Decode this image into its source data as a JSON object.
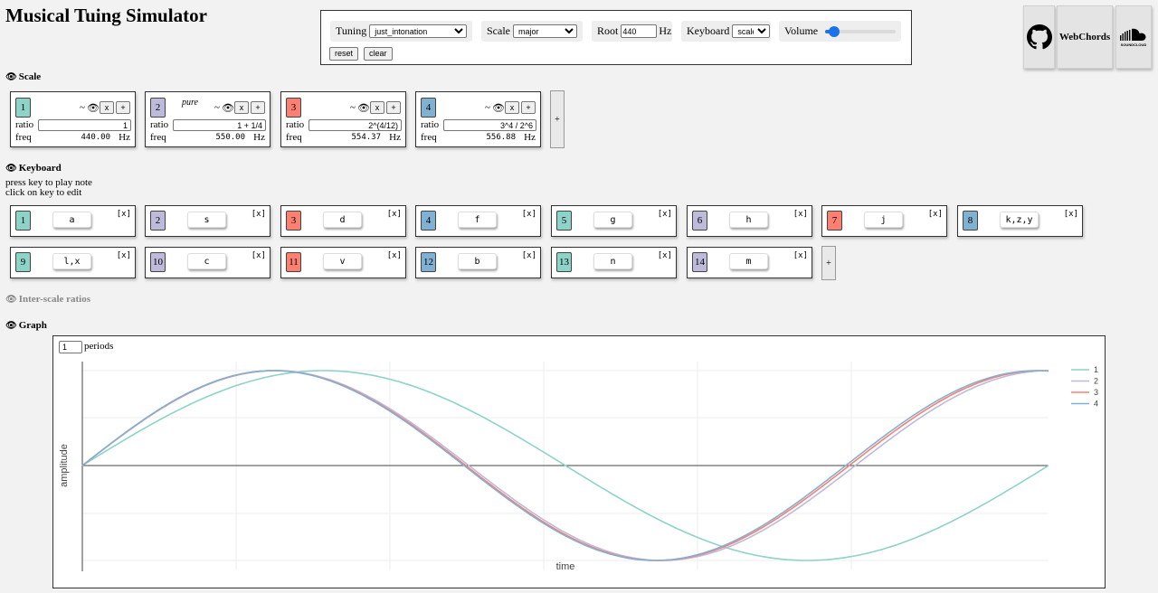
{
  "app": {
    "title": "Musical Tuing Simulator"
  },
  "controls": {
    "tuning_label": "Tuning",
    "tuning_value": "just_intonation",
    "scale_label": "Scale",
    "scale_value": "major",
    "root_label": "Root",
    "root_value": "440",
    "root_unit": "Hz",
    "keyboard_label": "Keyboard",
    "keyboard_value": "scale",
    "volume_label": "Volume",
    "volume_level": 0.05,
    "reset_label": "reset",
    "clear_label": "clear",
    "accent_color": "#1a73e8"
  },
  "links": {
    "github_icon": "github-icon",
    "webchords_label": "WebChords",
    "soundcloud_label": "SOUNDCLOUD",
    "soundcloud_icon": "soundcloud-icon"
  },
  "sections": {
    "scale": "Scale",
    "keyboard": "Keyboard",
    "inter_scale": "Inter-scale ratios",
    "graph": "Graph",
    "eye_icon": "eye-icon"
  },
  "scale": {
    "ratio_label": "ratio",
    "freq_label": "freq",
    "freq_unit": "Hz",
    "wave_symbol": "~",
    "eye_symbol": "👁",
    "remove_label": "x",
    "add_label": "+",
    "add_note_label": "+",
    "notes": [
      {
        "num": "1",
        "ratio": "1",
        "freq": "440.00",
        "tag": "",
        "color": "#8dd3c7"
      },
      {
        "num": "2",
        "ratio": "1 + 1/4",
        "freq": "550.00",
        "tag": "pure",
        "color": "#bebada"
      },
      {
        "num": "3",
        "ratio": "2^(4/12)",
        "freq": "554.37",
        "tag": "",
        "color": "#fb8072"
      },
      {
        "num": "4",
        "ratio": "3^4 / 2^6",
        "freq": "556.88",
        "tag": "",
        "color": "#80b1d3"
      }
    ]
  },
  "keyboard": {
    "hint_line1": "press key to play note",
    "hint_line2": "click on key to edit",
    "remove_label": "[x]",
    "add_label": "+",
    "keys": [
      {
        "num": "1",
        "key": "a",
        "color": "#8dd3c7"
      },
      {
        "num": "2",
        "key": "s",
        "color": "#bebada"
      },
      {
        "num": "3",
        "key": "d",
        "color": "#fb8072"
      },
      {
        "num": "4",
        "key": "f",
        "color": "#80b1d3"
      },
      {
        "num": "5",
        "key": "g",
        "color": "#8dd3c7"
      },
      {
        "num": "6",
        "key": "h",
        "color": "#bebada"
      },
      {
        "num": "7",
        "key": "j",
        "color": "#fb8072"
      },
      {
        "num": "8",
        "key": "k,z,y",
        "color": "#80b1d3"
      },
      {
        "num": "9",
        "key": "l,x",
        "color": "#8dd3c7"
      },
      {
        "num": "10",
        "key": "c",
        "color": "#bebada"
      },
      {
        "num": "11",
        "key": "v",
        "color": "#fb8072"
      },
      {
        "num": "12",
        "key": "b",
        "color": "#80b1d3"
      },
      {
        "num": "13",
        "key": "n",
        "color": "#8dd3c7"
      },
      {
        "num": "14",
        "key": "m",
        "color": "#bebada"
      }
    ]
  },
  "graph": {
    "periods_value": "1",
    "periods_label": "periods",
    "chart_data": {
      "type": "line",
      "xlabel": "time",
      "ylabel": "amplitude",
      "legend_position": "top-right",
      "grid": true,
      "ylim": [
        -1,
        1
      ],
      "xlim": [
        0,
        1.26
      ],
      "series": [
        {
          "name": "1",
          "freq_ratio": 1.0,
          "color": "#8dd3c7"
        },
        {
          "name": "2",
          "freq_ratio": 1.25,
          "color": "#bebada"
        },
        {
          "name": "3",
          "freq_ratio": 1.2599,
          "color": "#fb8072"
        },
        {
          "name": "4",
          "freq_ratio": 1.2656,
          "color": "#80b1d3"
        }
      ]
    }
  }
}
